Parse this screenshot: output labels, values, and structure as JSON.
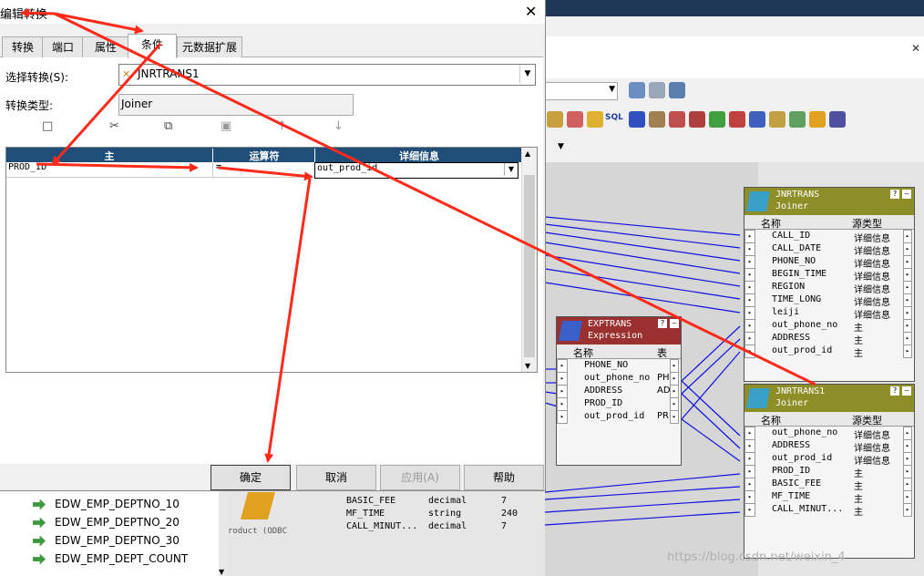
{
  "dialog": {
    "title": "编辑转换",
    "close": "✕",
    "tabs": [
      {
        "label": "转换"
      },
      {
        "label": "端口"
      },
      {
        "label": "属性"
      },
      {
        "label": "条件",
        "active": true
      },
      {
        "label": "元数据扩展"
      }
    ],
    "select_label": "选择转换(S):",
    "select_value": "JNRTRANS1",
    "type_label": "转换类型:",
    "type_value": "Joiner",
    "condition_table": {
      "headers": [
        "主",
        "运算符",
        "详细信息"
      ],
      "rows": [
        {
          "master": "PROD_ID",
          "operator": "=",
          "detail": "out_prod_id"
        }
      ]
    },
    "buttons": {
      "ok": "确定",
      "cancel": "取消",
      "apply": "应用(A)",
      "help": "帮助"
    }
  },
  "background": {
    "joiner1": {
      "name": "JNRTRANS",
      "type": "Joiner",
      "col_name": "名称",
      "col_source": "源类型",
      "rows": [
        {
          "name": "CALL_ID",
          "src": "详细信息"
        },
        {
          "name": "CALL_DATE",
          "src": "详细信息"
        },
        {
          "name": "PHONE_NO",
          "src": "详细信息"
        },
        {
          "name": "BEGIN_TIME",
          "src": "详细信息"
        },
        {
          "name": "REGION",
          "src": "详细信息"
        },
        {
          "name": "TIME_LONG",
          "src": "详细信息"
        },
        {
          "name": "leiji",
          "src": "详细信息"
        },
        {
          "name": "out_phone_no",
          "src": "主"
        },
        {
          "name": "ADDRESS",
          "src": "主"
        },
        {
          "name": "out_prod_id",
          "src": "主"
        }
      ]
    },
    "expression": {
      "name": "EXPTRANS",
      "type": "Expression",
      "col_name": "名称",
      "col_expr": "表",
      "rows": [
        {
          "name": "PHONE_NO",
          "v": ""
        },
        {
          "name": "out_phone_no",
          "v": "PH"
        },
        {
          "name": "ADDRESS",
          "v": "AD"
        },
        {
          "name": "PROD_ID",
          "v": ""
        },
        {
          "name": "out_prod_id",
          "v": "PR"
        }
      ]
    },
    "joiner2": {
      "name": "JNRTRANS1",
      "type": "Joiner",
      "col_name": "名称",
      "col_source": "源类型",
      "rows": [
        {
          "name": "out_phone_no",
          "src": "详细信息"
        },
        {
          "name": "ADDRESS",
          "src": "详细信息"
        },
        {
          "name": "out_prod_id",
          "src": "详细信息"
        },
        {
          "name": "PROD_ID",
          "src": "主"
        },
        {
          "name": "BASIC_FEE",
          "src": "主"
        },
        {
          "name": "MF_TIME",
          "src": "主"
        },
        {
          "name": "CALL_MINUT...",
          "src": "主"
        }
      ]
    },
    "tree_items": [
      "EDW_EMP_DEPTNO_10",
      "EDW_EMP_DEPTNO_20",
      "EDW_EMP_DEPTNO_30",
      "EDW_EMP_DEPT_COUNT"
    ],
    "source_label": "roduct (ODBC",
    "bottom_rows": [
      {
        "name": "BASIC_FEE",
        "type": "decimal",
        "len": "7"
      },
      {
        "name": "MF_TIME",
        "type": "string",
        "len": "240"
      },
      {
        "name": "CALL_MINUT...",
        "type": "decimal",
        "len": "7"
      }
    ],
    "watermark": "https://blog.csdn.net/weixin_4"
  },
  "colors": {
    "arrow": "#ff2a1a",
    "header_blue": "#1f4e79",
    "joiner_header": "#8e8e28",
    "expression_header": "#9b3030",
    "link_blue": "#1010e0"
  }
}
